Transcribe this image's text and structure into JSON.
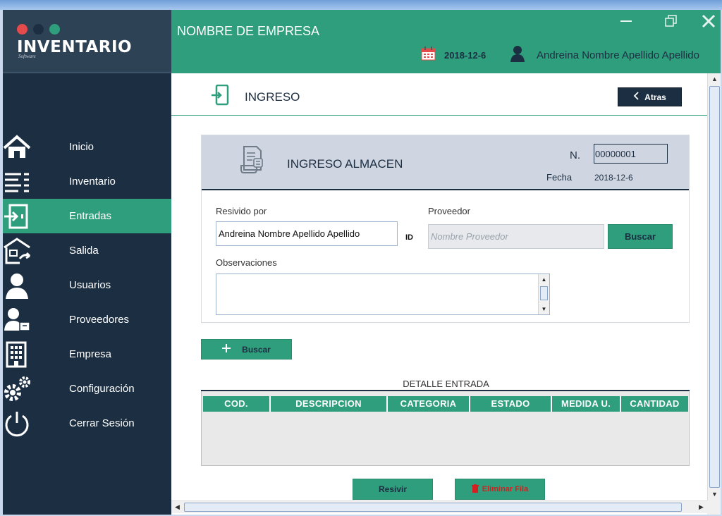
{
  "brand": {
    "name": "INVENTARIO",
    "subtitle": "Software",
    "dot_colors": [
      "#e54b4b",
      "#1c2e42",
      "#2f9e7c"
    ]
  },
  "header": {
    "company": "NOMBRE DE EMPRESA",
    "date": "2018-12-6",
    "user": "Andreina Nombre Apellido Apellido",
    "controls": [
      "minimize-icon",
      "restore-icon",
      "close-icon"
    ]
  },
  "sidebar": {
    "items": [
      {
        "label": "Inicio",
        "icon": "home-icon"
      },
      {
        "label": "Inventario",
        "icon": "list-icon"
      },
      {
        "label": "Entradas",
        "icon": "enter-icon",
        "active": true
      },
      {
        "label": "Salida",
        "icon": "warehouse-exit-icon"
      },
      {
        "label": "Usuarios",
        "icon": "user-icon"
      },
      {
        "label": "Proveedores",
        "icon": "supplier-icon"
      },
      {
        "label": "Empresa",
        "icon": "building-icon"
      },
      {
        "label": "Configuración",
        "icon": "gears-icon"
      },
      {
        "label": "Cerrar Sesión",
        "icon": "power-icon"
      }
    ]
  },
  "page": {
    "title": "INGRESO",
    "back_label": "Atras"
  },
  "form": {
    "card_title": "INGRESO ALMACEN",
    "n_label": "N.",
    "n_value": "00000001",
    "fecha_label": "Fecha",
    "fecha_value": "2018-12-6",
    "received_by_label": "Resivido por",
    "received_by_value": "Andreina Nombre Apellido Apellido",
    "id_label": "ID",
    "supplier_label": "Proveedor",
    "supplier_placeholder": "Nombre Proveedor",
    "search_supplier_label": "Buscar",
    "observations_label": "Observaciones",
    "observations_value": ""
  },
  "detail": {
    "add_button_label": "Buscar",
    "title": "DETALLE ENTRADA",
    "columns": [
      "COD.",
      "DESCRIPCION",
      "CATEGORIA",
      "ESTADO",
      "MEDIDA U.",
      "CANTIDAD"
    ],
    "rows": []
  },
  "actions": {
    "receive_label": "Resivir",
    "delete_row_label": "Eliminar Fila"
  },
  "colors": {
    "accent_green": "#2f9e7c",
    "navy": "#1c2e42",
    "danger": "#d32020"
  }
}
